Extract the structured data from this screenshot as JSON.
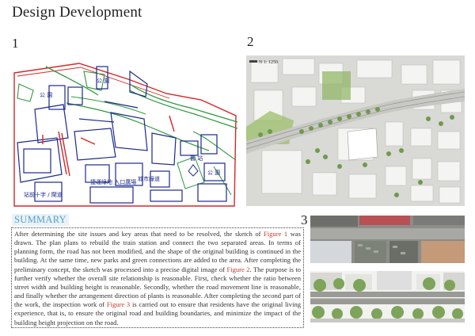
{
  "page": {
    "title": "Design Development"
  },
  "figures": {
    "fig1_number": "1",
    "fig2_number": "2",
    "fig3_number": "3",
    "fig2_scale_label": "N 1: 1250",
    "fig1_handwritten_labels": [
      "公 園",
      "公 園",
      "站前十字 / 閘道",
      "捷運綠地 入口廣場",
      "城市綠道",
      "公 園",
      "舊 站"
    ]
  },
  "summary": {
    "heading": "SUMMARY",
    "text_part1": "After determining the site issues and key areas that need to be resolved, the sketch of ",
    "fig_ref1": "Figure 1",
    "text_part2": " was drawn. The plan plans to rebuild the train station and connect the two separated areas. In terms of planning form, the road has not been modified, and the shape of the original building is continued in the building. At the same time, new parks and green connections are added to the area. After completing the preliminary concept, the sketch was processed into a precise digital image of ",
    "fig_ref2": "Figure 2",
    "text_part3": ". The purpose is to further verify whether the overall site relationship is reasonable. First, check whether the ratio between street width and building height is reasonable. Secondly, whether the road movement line is reasonable, and finally whether the arrangement direction of plants is reasonable. After completing the second part of the work, the inspection work of ",
    "fig_ref3": "Figure 3",
    "text_part4": " is carried out to ensure that residents have the original living experience, that is, to ensure the original road and building boundaries, and minimize the impact of the building height projection on the road."
  },
  "colors": {
    "heading_blue": "#5aa0c8",
    "figure_ref_red": "#c0392b",
    "sketch_red": "#d62828",
    "sketch_blue": "#1c2a8c",
    "sketch_green": "#2e9a3e"
  }
}
